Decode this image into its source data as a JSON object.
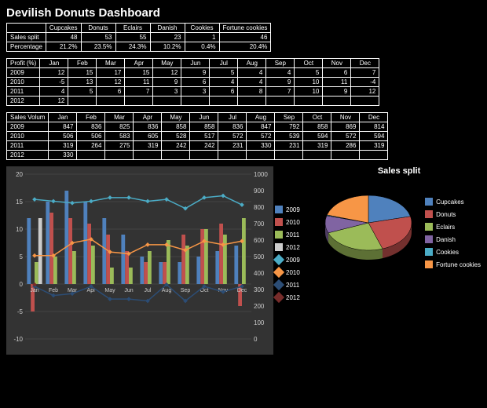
{
  "title": "Devilish Donuts Dashboard",
  "sales_split": {
    "headers": [
      "",
      "Cupcakes",
      "Donuts",
      "Eclairs",
      "Danish",
      "Cookies",
      "Fortune cookies"
    ],
    "rows": [
      {
        "label": "Sales split",
        "values": [
          "48",
          "53",
          "55",
          "23",
          "1",
          "46"
        ]
      },
      {
        "label": "Percentage",
        "values": [
          "21.2%",
          "23.5%",
          "24.3%",
          "10.2%",
          "0.4%",
          "20.4%"
        ]
      }
    ]
  },
  "profit": {
    "headers": [
      "Profit (%)",
      "Jan",
      "Feb",
      "Mar",
      "Apr",
      "May",
      "Jun",
      "Jul",
      "Aug",
      "Sep",
      "Oct",
      "Nov",
      "Dec"
    ],
    "rows": [
      {
        "label": "2009",
        "values": [
          "12",
          "15",
          "17",
          "15",
          "12",
          "9",
          "5",
          "4",
          "4",
          "5",
          "6",
          "7"
        ]
      },
      {
        "label": "2010",
        "values": [
          "-5",
          "13",
          "12",
          "11",
          "9",
          "6",
          "4",
          "4",
          "9",
          "10",
          "11",
          "-4"
        ]
      },
      {
        "label": "2011",
        "values": [
          "4",
          "5",
          "6",
          "7",
          "3",
          "3",
          "6",
          "8",
          "7",
          "10",
          "9",
          "12"
        ]
      },
      {
        "label": "2012",
        "values": [
          "12",
          "",
          "",
          "",
          "",
          "",
          "",
          "",
          "",
          "",
          "",
          ""
        ]
      }
    ]
  },
  "volume": {
    "headers": [
      "Sales Volum",
      "Jan",
      "Feb",
      "Mar",
      "Apr",
      "May",
      "Jun",
      "Jul",
      "Aug",
      "Sep",
      "Oct",
      "Nov",
      "Dec"
    ],
    "rows": [
      {
        "label": "2009",
        "values": [
          "847",
          "836",
          "825",
          "836",
          "858",
          "858",
          "836",
          "847",
          "792",
          "858",
          "869",
          "814"
        ]
      },
      {
        "label": "2010",
        "values": [
          "506",
          "506",
          "583",
          "605",
          "528",
          "517",
          "572",
          "572",
          "539",
          "594",
          "572",
          "594"
        ]
      },
      {
        "label": "2011",
        "values": [
          "319",
          "264",
          "275",
          "319",
          "242",
          "242",
          "231",
          "330",
          "231",
          "319",
          "286",
          "319"
        ]
      },
      {
        "label": "2012",
        "values": [
          "330",
          "",
          "",
          "",
          "",
          "",
          "",
          "",
          "",
          "",
          "",
          ""
        ]
      }
    ]
  },
  "pie": {
    "title": "Sales split"
  },
  "chart_data": [
    {
      "type": "bar+line",
      "categories": [
        "Jan",
        "Feb",
        "Mar",
        "Apr",
        "May",
        "Jun",
        "Jul",
        "Aug",
        "Sep",
        "Oct",
        "Nov",
        "Dec"
      ],
      "bar_series": [
        {
          "name": "2009",
          "color": "#4f81bd",
          "values": [
            12,
            15,
            17,
            15,
            12,
            9,
            5,
            4,
            4,
            5,
            6,
            7
          ]
        },
        {
          "name": "2010",
          "color": "#c0504d",
          "values": [
            -5,
            13,
            12,
            11,
            9,
            6,
            4,
            4,
            9,
            10,
            11,
            -4
          ]
        },
        {
          "name": "2011",
          "color": "#9bbb59",
          "values": [
            4,
            5,
            6,
            7,
            3,
            3,
            6,
            8,
            7,
            10,
            9,
            12
          ]
        },
        {
          "name": "2012",
          "color": "#cccccc",
          "values": [
            12,
            null,
            null,
            null,
            null,
            null,
            null,
            null,
            null,
            null,
            null,
            null
          ]
        }
      ],
      "line_series": [
        {
          "name": "2009",
          "color": "#4bacc6",
          "values": [
            847,
            836,
            825,
            836,
            858,
            858,
            836,
            847,
            792,
            858,
            869,
            814
          ]
        },
        {
          "name": "2010",
          "color": "#f79646",
          "values": [
            506,
            506,
            583,
            605,
            528,
            517,
            572,
            572,
            539,
            594,
            572,
            594
          ]
        },
        {
          "name": "2011",
          "color": "#2c4d75",
          "values": [
            319,
            264,
            275,
            319,
            242,
            242,
            231,
            330,
            231,
            319,
            286,
            319
          ]
        },
        {
          "name": "2012",
          "color": "#772c2a",
          "values": [
            330,
            null,
            null,
            null,
            null,
            null,
            null,
            null,
            null,
            null,
            null,
            null
          ]
        }
      ],
      "ylim_left": [
        -10,
        20
      ],
      "ylim_right": [
        0,
        1000
      ],
      "left_ticks": [
        -10,
        -5,
        0,
        5,
        10,
        15,
        20
      ],
      "right_ticks": [
        0,
        100,
        200,
        300,
        400,
        500,
        600,
        700,
        800,
        900,
        1000
      ]
    },
    {
      "type": "pie",
      "title": "Sales split",
      "series": [
        {
          "name": "Cupcakes",
          "value": 48,
          "color": "#4f81bd"
        },
        {
          "name": "Donuts",
          "value": 53,
          "color": "#c0504d"
        },
        {
          "name": "Eclairs",
          "value": 55,
          "color": "#9bbb59"
        },
        {
          "name": "Danish",
          "value": 23,
          "color": "#8064a2"
        },
        {
          "name": "Cookies",
          "value": 1,
          "color": "#4bacc6"
        },
        {
          "name": "Fortune cookies",
          "value": 46,
          "color": "#f79646"
        }
      ]
    }
  ]
}
